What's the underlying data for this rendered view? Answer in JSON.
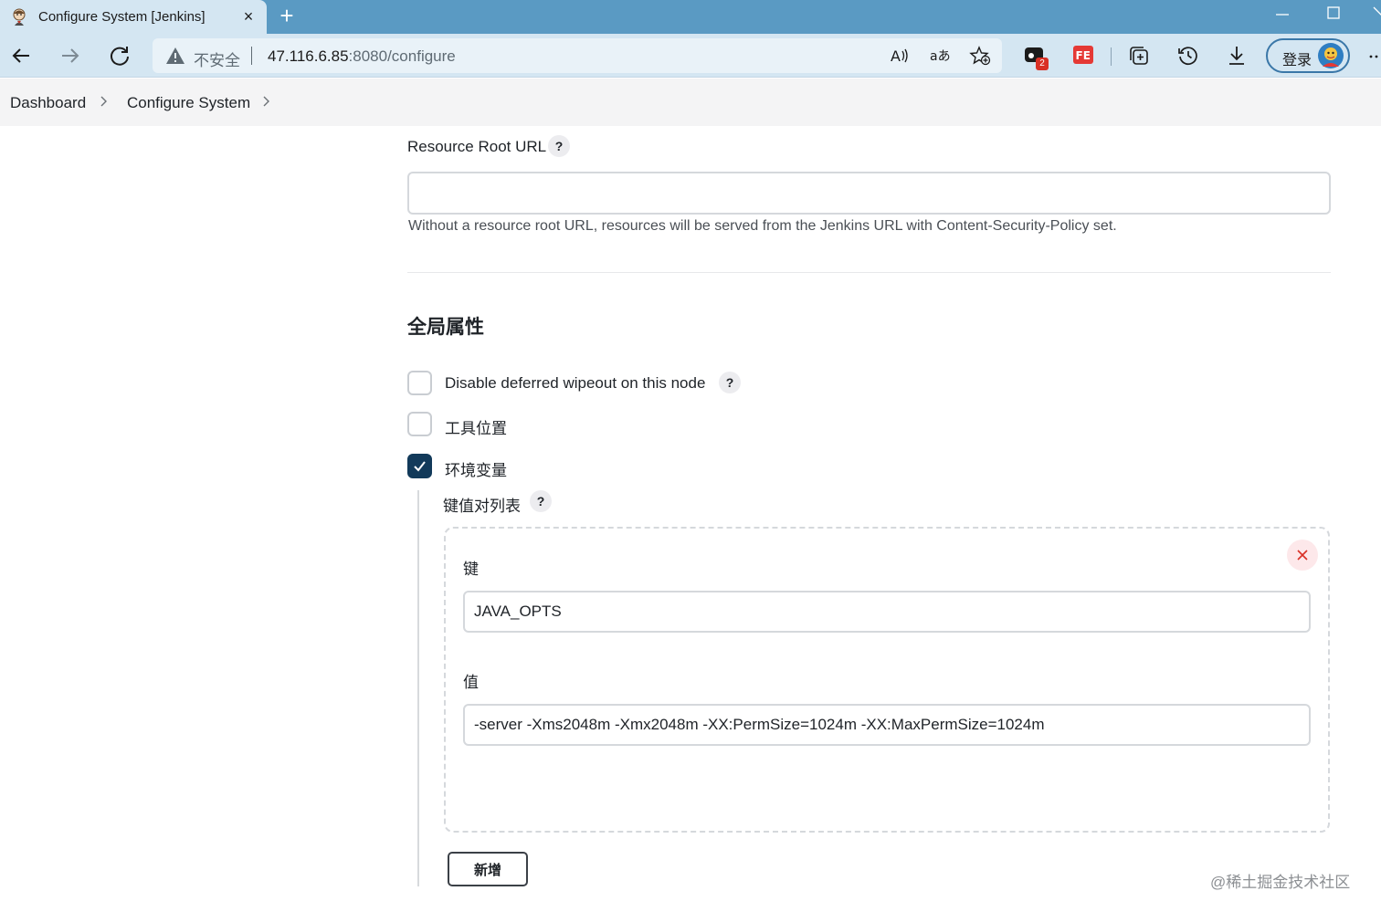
{
  "browser": {
    "tab": {
      "title": "Configure System [Jenkins]",
      "favicon": "jenkins-icon",
      "close": "×"
    },
    "new_tab": "+",
    "address": {
      "security_label": "不安全",
      "url_host": "47.116.6.85",
      "url_rest": ":8080/configure"
    },
    "toolbar_icons": [
      "back-icon",
      "forward-icon",
      "refresh-icon",
      "read-aloud-icon",
      "translate-icon",
      "favorites-icon",
      "extension-icon",
      "fe-extension-icon",
      "collections-icon",
      "history-icon",
      "download-icon",
      "more-icon"
    ],
    "extension_badge": "2",
    "login_label": "登录",
    "colors": {
      "tabstrip": "#5a9ac3",
      "toolbar": "#d4e6f2",
      "accent": "#123a5a",
      "danger": "#d93025"
    }
  },
  "breadcrumb": {
    "items": [
      "Dashboard",
      "Configure System"
    ]
  },
  "resource_root": {
    "title": "Resource Root URL",
    "help": "?",
    "value": "",
    "description": "Without a resource root URL, resources will be served from the Jenkins URL with Content-Security-Policy set."
  },
  "global_properties": {
    "heading": "全局属性",
    "options": [
      {
        "label": "Disable deferred wipeout on this node",
        "checked": false,
        "help": "?"
      },
      {
        "label": "工具位置",
        "checked": false
      },
      {
        "label": "环境变量",
        "checked": true
      }
    ],
    "env_vars": {
      "list_label": "键值对列表",
      "help": "?",
      "entry": {
        "key_label": "键",
        "key_value": "JAVA_OPTS",
        "value_label": "值",
        "value_value": "-server -Xms2048m -Xmx2048m -XX:PermSize=1024m -XX:MaxPermSize=1024m"
      },
      "add_button": "新增"
    }
  },
  "watermark": "@稀土掘金技术社区"
}
